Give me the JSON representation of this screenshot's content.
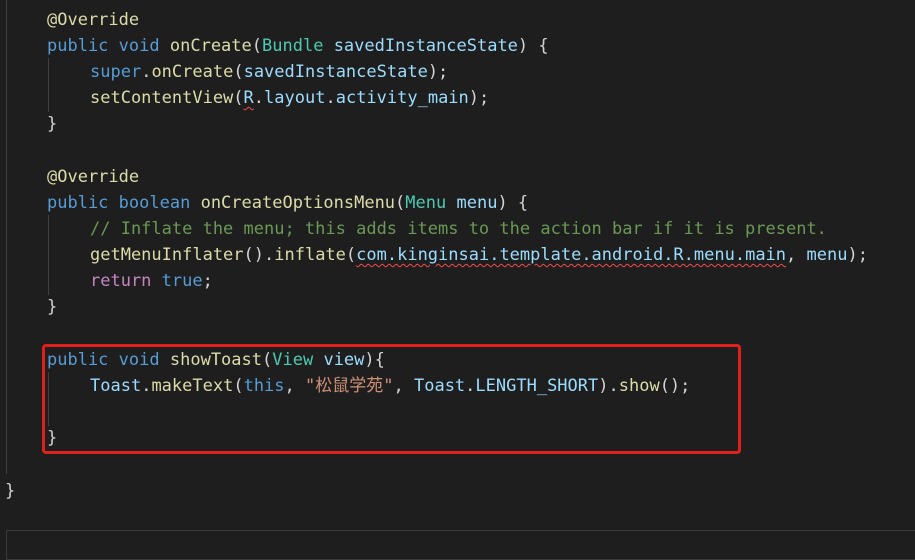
{
  "code": {
    "l1": {
      "annotation": "@Override"
    },
    "l2": {
      "public": "public",
      "void": "void",
      "method": "onCreate",
      "open_paren": "(",
      "type": "Bundle",
      "param": "savedInstanceState",
      "close": ") {"
    },
    "l3": {
      "super": "super",
      "dot": ".",
      "method": "onCreate",
      "open_paren": "(",
      "arg": "savedInstanceState",
      "close": ");"
    },
    "l4": {
      "method": "setContentView",
      "open_paren": "(",
      "r": "R",
      "dot1": ".",
      "layout": "layout",
      "dot2": ".",
      "field": "activity_main",
      "close": ");"
    },
    "l5": {
      "brace": "}"
    },
    "l7": {
      "annotation": "@Override"
    },
    "l8": {
      "public": "public",
      "boolean": "boolean",
      "method": "onCreateOptionsMenu",
      "open_paren": "(",
      "type": "Menu",
      "param": "menu",
      "close": ") {"
    },
    "l9": {
      "comment": "// Inflate the menu; this adds items to the action bar if it is present."
    },
    "l10": {
      "getter": "getMenuInflater",
      "mid": "().",
      "inflate": "inflate",
      "open_paren": "(",
      "pkg": "com.kinginsai.template.android.R.menu.main",
      "comma": ", ",
      "arg": "menu",
      "close": ");"
    },
    "l11": {
      "return": "return",
      "true": "true",
      "semi": ";"
    },
    "l12": {
      "brace": "}"
    },
    "l14": {
      "public": "public",
      "void": "void",
      "method": "showToast",
      "open_paren": "(",
      "type": "View",
      "param": "view",
      "close": "){"
    },
    "l15": {
      "class": "Toast",
      "dot": ".",
      "method": "makeText",
      "open_paren": "(",
      "this": "this",
      "comma1": ", ",
      "string": "\"松鼠学苑\"",
      "comma2": ", ",
      "class2": "Toast",
      "dot2": ".",
      "const": "LENGTH_SHORT",
      "mid": ").",
      "show": "show",
      "close": "();"
    },
    "l17": {
      "brace": "}"
    },
    "l19": {
      "brace": "}"
    }
  },
  "colors": {
    "background": "#1e1e1e",
    "keyword": "#569cd6",
    "control": "#c586c0",
    "function": "#dcdcaa",
    "type": "#4ec9b0",
    "variable": "#9cdcfe",
    "string": "#ce9178",
    "comment": "#6a9955",
    "error_squiggle": "#f14c4c",
    "highlight_box": "#e0201c"
  }
}
